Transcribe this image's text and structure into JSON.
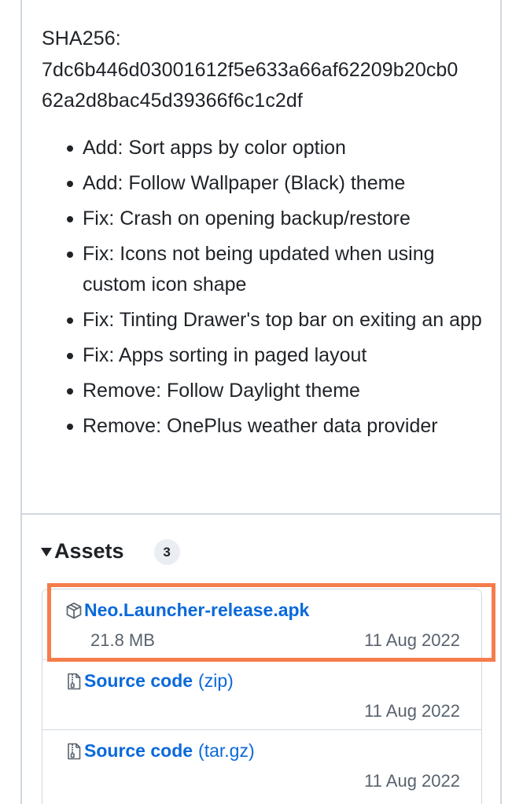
{
  "release": {
    "sha_label": "SHA256:",
    "sha_line1": "7dc6b446d03001612f5e633a66af62209b20cb0",
    "sha_line2": "62a2d8bac45d39366f6c1c2df",
    "changes": [
      "Add: Sort apps by color option",
      "Add: Follow Wallpaper (Black) theme",
      "Fix: Crash on opening backup/restore",
      "Fix: Icons not being updated when using custom icon shape",
      "Fix: Tinting Drawer's top bar on exiting an app",
      "Fix: Apps sorting in paged layout",
      "Remove: Follow Daylight theme",
      "Remove: OnePlus weather data provider"
    ]
  },
  "assets": {
    "title": "Assets",
    "count": "3",
    "items": [
      {
        "name": "Neo.Launcher-release.apk",
        "suffix": "",
        "size": "21.8 MB",
        "date": "11 Aug 2022",
        "icon": "package-icon"
      },
      {
        "name": "Source code",
        "suffix": "(zip)",
        "size": "",
        "date": "11 Aug 2022",
        "icon": "file-zip-icon"
      },
      {
        "name": "Source code",
        "suffix": "(tar.gz)",
        "size": "",
        "date": "11 Aug 2022",
        "icon": "file-zip-icon"
      }
    ]
  },
  "colors": {
    "link": "#0969da",
    "highlight": "#f47d4b",
    "border": "#d0d7de"
  }
}
